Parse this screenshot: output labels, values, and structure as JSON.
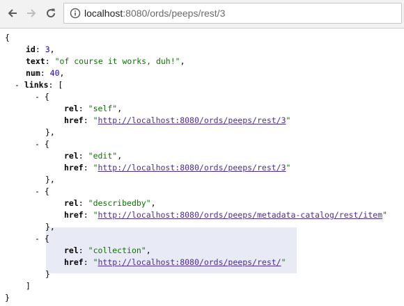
{
  "browser": {
    "url_host": "localhost",
    "url_rest": ":8080/ords/peeps/rest/3"
  },
  "json": {
    "open_brace": "{",
    "close_brace": "}",
    "id_key": "id",
    "id_value": "3",
    "text_key": "text",
    "text_value": "\"of course it works, duh!\"",
    "num_key": "num",
    "num_value": "40",
    "links_toggle": "-",
    "links_key": "links",
    "links_open": "[",
    "links_close": "]",
    "links": [
      {
        "toggle": "-",
        "rel": "\"self\"",
        "href_url": "http://localhost:8080/ords/peeps/rest/3"
      },
      {
        "toggle": "-",
        "rel": "\"edit\"",
        "href_url": "http://localhost:8080/ords/peeps/rest/3"
      },
      {
        "toggle": "-",
        "rel": "\"describedby\"",
        "href_url": "http://localhost:8080/ords/peeps/metadata-catalog/rest/item"
      },
      {
        "toggle": "-",
        "rel": "\"collection\"",
        "href_url": "http://localhost:8080/ords/peeps/rest/"
      }
    ],
    "rel_key": "rel",
    "href_key": "href",
    "quote": "\"",
    "item_open": "{",
    "item_close": "},",
    "item_close_last": "}"
  },
  "colors": {
    "string": "#0b7500",
    "number": "#1a01cc",
    "link": "#4a2c98",
    "highlight": "#e8eaf6"
  },
  "icons": [
    "back-arrow-icon",
    "forward-arrow-icon",
    "reload-icon",
    "info-icon"
  ]
}
